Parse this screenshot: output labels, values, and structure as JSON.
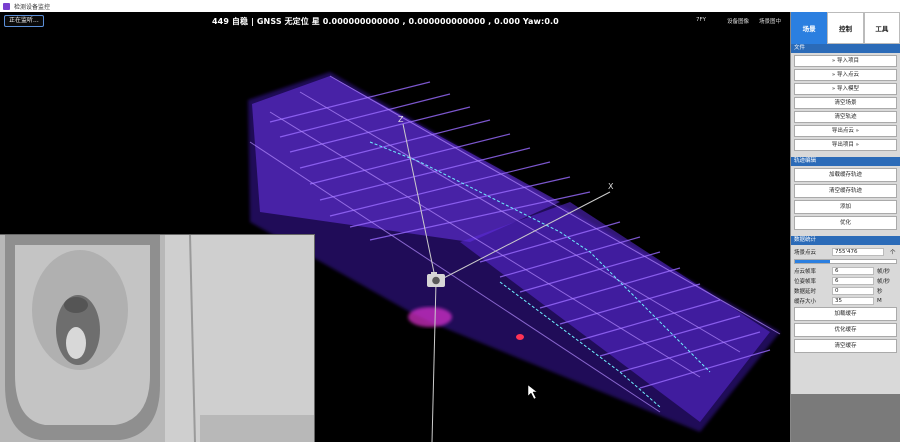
{
  "window": {
    "title": "检测设备监控"
  },
  "viewport": {
    "status_button": "正在监听...",
    "status_line": "449  自稳  |  GNSS 无定位 星  0.000000000000 , 0.000000000000 , 0.000   Yaw:0.0",
    "top_right": {
      "fps": "7FY",
      "device": "设备图像",
      "scene": "场景图中"
    },
    "axis_labels": {
      "z": "Z",
      "x": "X"
    }
  },
  "panel": {
    "tabs": [
      {
        "label": "场景",
        "active": true
      },
      {
        "label": "控制",
        "active": false
      },
      {
        "label": "工具",
        "active": false
      }
    ],
    "file_section": {
      "header": "文件",
      "buttons": [
        "导入项目",
        "导入点云",
        "导入模型",
        "清空场景",
        "清空轨迹",
        "导出点云",
        "导出项目"
      ]
    },
    "track_section": {
      "header": "轨迹编辑",
      "buttons": [
        "加载缓存轨迹",
        "清空缓存轨迹",
        "添加",
        "优化"
      ]
    },
    "stats_section": {
      "header": "数据统计",
      "scene_points": {
        "label": "场景点云",
        "value": "755'476",
        "unit": "个"
      },
      "progress": 0.35,
      "rows": [
        {
          "label": "点云帧率",
          "value": "6",
          "unit": "帧/秒"
        },
        {
          "label": "位姿帧率",
          "value": "6",
          "unit": "帧/秒"
        },
        {
          "label": "数据延时",
          "value": "0",
          "unit": "秒"
        },
        {
          "label": "缓存大小",
          "value": "35",
          "unit": "M"
        }
      ],
      "buttons": [
        "加载缓存",
        "优化缓存",
        "清空缓存"
      ]
    }
  },
  "colors": {
    "accent": "#2b7fe0",
    "cloud": "#7a3cff",
    "cloud_hot": "#e030d0"
  }
}
